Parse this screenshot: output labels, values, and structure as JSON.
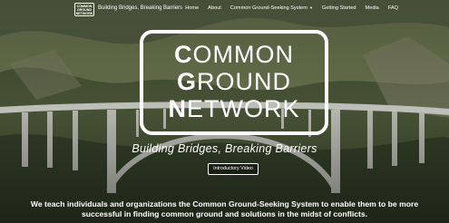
{
  "header": {
    "logo_lines": [
      "COMMON",
      "GROUND",
      "NETWORK"
    ],
    "tagline": "Building Bridges, Breaking Barriers",
    "nav": [
      {
        "label": "Home",
        "has_dropdown": false
      },
      {
        "label": "About",
        "has_dropdown": false
      },
      {
        "label": "Common Ground-Seeking System",
        "has_dropdown": true
      },
      {
        "label": "Getting Started",
        "has_dropdown": false
      },
      {
        "label": "Media",
        "has_dropdown": false
      },
      {
        "label": "FAQ",
        "has_dropdown": false
      }
    ]
  },
  "hero": {
    "brand": {
      "line1_initial": "C",
      "line1_rest": "OMMON",
      "line2_initial": "G",
      "line2_rest": "ROUND",
      "line3_initial": "N",
      "line3_rest": "ETWORK"
    },
    "subtitle": "Building Bridges, Breaking Barriers",
    "video_button": "Introductory Video",
    "mission_line1": "We teach individuals and organizations the Common Ground-Seeking System to enable them to be more",
    "mission_line2": "successful in finding common ground and solutions in the midst of conflicts."
  },
  "colors": {
    "text": "#ffffff",
    "foliage_dark": "#2f3d2a",
    "foliage_light": "#7d8a5c",
    "bridge": "#cfd1c9"
  },
  "icons": {
    "dropdown": "chevron-down-icon"
  }
}
